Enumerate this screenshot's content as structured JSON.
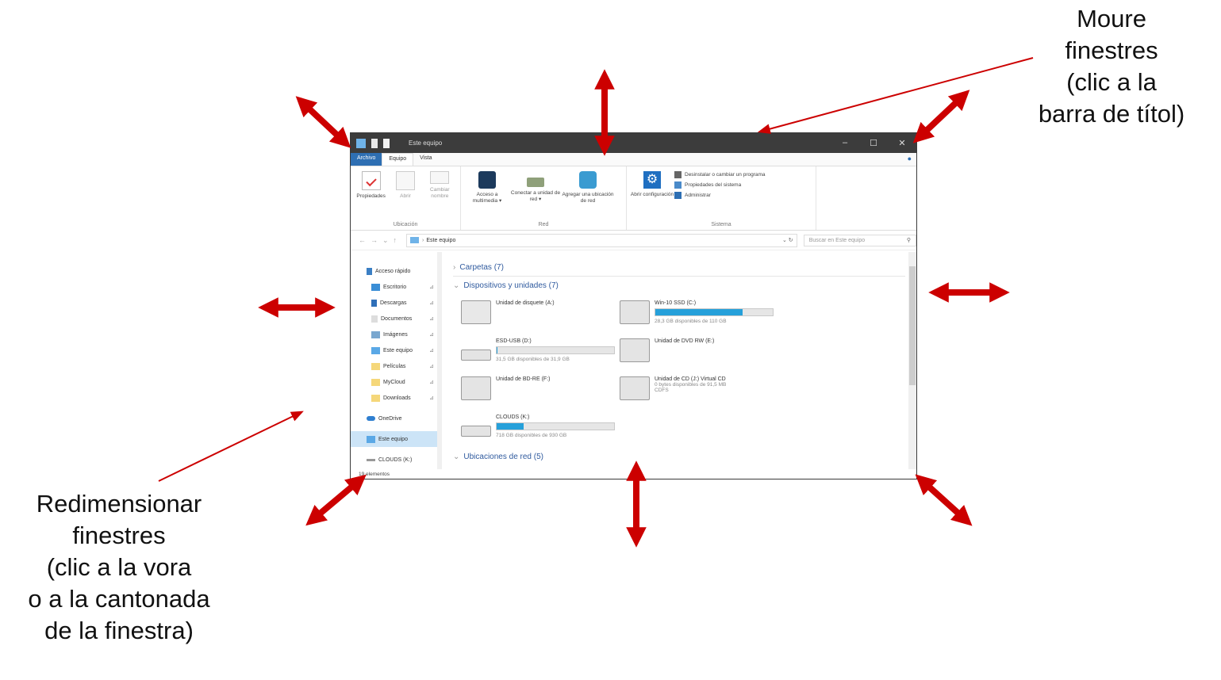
{
  "annotations": {
    "move": [
      "Moure",
      "finestres",
      "(clic a la",
      "barra de títol)"
    ],
    "resize": [
      "Redimensionar",
      "finestres",
      "(clic a la vora",
      "o a la cantonada",
      "de la finestra)"
    ]
  },
  "colors": {
    "arrow": "#cc0000",
    "titlebar": "#3c3c3c",
    "accent": "#2e6fb3",
    "bar": "#26a0da"
  },
  "window": {
    "title": "Este equipo",
    "controls": [
      "–",
      "☐",
      "✕"
    ],
    "tabs": {
      "file": "Archivo",
      "equipo": "Equipo",
      "vista": "Vista"
    },
    "ribbon": {
      "ubicacion": {
        "label": "Ubicación",
        "propiedades": "Propiedades",
        "abrir": "Abrir",
        "cambiar_nombre": "Cambiar nombre"
      },
      "red": {
        "label": "Red",
        "acceso": "Acceso a multimedia ▾",
        "conectar": "Conectar a unidad de red ▾",
        "agregar": "Agregar una ubicación de red"
      },
      "sistema": {
        "label": "Sistema",
        "abrir_config": "Abrir configuración",
        "desinstalar": "Desinstalar o cambiar un programa",
        "propiedades": "Propiedades del sistema",
        "administrar": "Administrar"
      }
    },
    "address": "Este equipo",
    "search_placeholder": "Buscar en Este equipo",
    "nav": {
      "acceso": "Acceso rápido",
      "escritorio": "Escritorio",
      "descargas": "Descargas",
      "documentos": "Documentos",
      "imagenes": "Imágenes",
      "este_equipo": "Este equipo",
      "peliculas": "Películas",
      "mycloud": "MyCloud",
      "downloads": "Downloads",
      "onedrive": "OneDrive",
      "este_equipo2": "Este equipo",
      "clouds": "CLOUDS (K:)"
    },
    "sections": {
      "carpetas": "Carpetas (7)",
      "dispositivos": "Dispositivos y unidades (7)",
      "red": "Ubicaciones de red (5)"
    },
    "drives": {
      "disquete": {
        "name": "Unidad de disquete (A:)"
      },
      "c": {
        "name": "Win-10 SSD (C:)",
        "free": "28,3 GB disponibles de 110 GB",
        "used_fraction": 0.74
      },
      "d": {
        "name": "ESD-USB (D:)",
        "free": "31,5 GB disponibles de 31,9 GB",
        "used_fraction": 0.01
      },
      "e": {
        "name": "Unidad de DVD RW (E:)"
      },
      "f": {
        "name": "Unidad de BD-RE (F:)"
      },
      "j": {
        "name": "Unidad de CD (J:) Virtual CD",
        "free": "0 bytes disponibles de 91,5 MB",
        "fs": "CDFS"
      },
      "k": {
        "name": "CLOUDS (K:)",
        "free": "718 GB disponibles de 930 GB",
        "used_fraction": 0.23
      }
    },
    "status": "19 elementos"
  }
}
